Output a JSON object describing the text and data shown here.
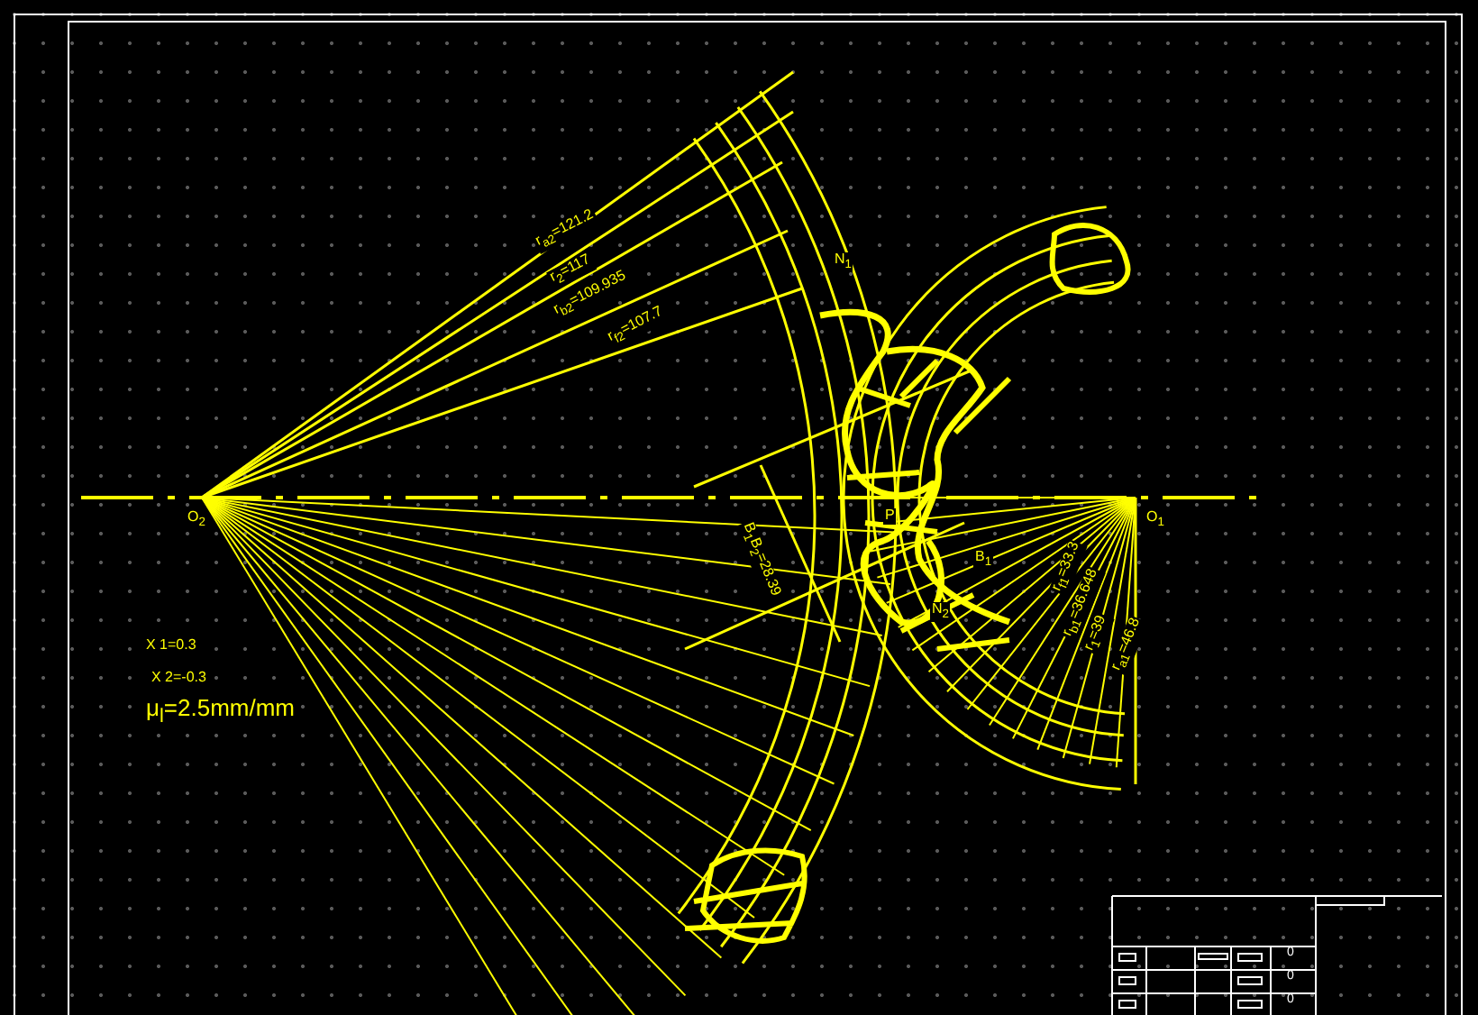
{
  "gear2_radius_labels": [
    "r$_{a2}$=121.2",
    "r$_{2}$=117",
    "r$_{b2}$=109.935",
    "r$_{f2}$=107.7"
  ],
  "gear1_radius_labels": [
    "r$_{f1}$=33.3",
    "r$_{b1}$=36.648",
    "r$_{1}$=39",
    "r$_{a1}$=46.8"
  ],
  "action_line_label": "B$_{1}$B$_{2}$=28.39",
  "points": [
    "O$_{2}$",
    "O$_{1}$",
    "N$_{1}$",
    "N$_{2}$",
    "P",
    "B$_{1}$"
  ],
  "shift_coefficients": [
    "X 1=0.3",
    "X 2=-0.3"
  ],
  "scale": "μ$_{l}$=2.5mm/mm",
  "title_block": {
    "cells": [
      "0",
      "0",
      "0"
    ]
  }
}
